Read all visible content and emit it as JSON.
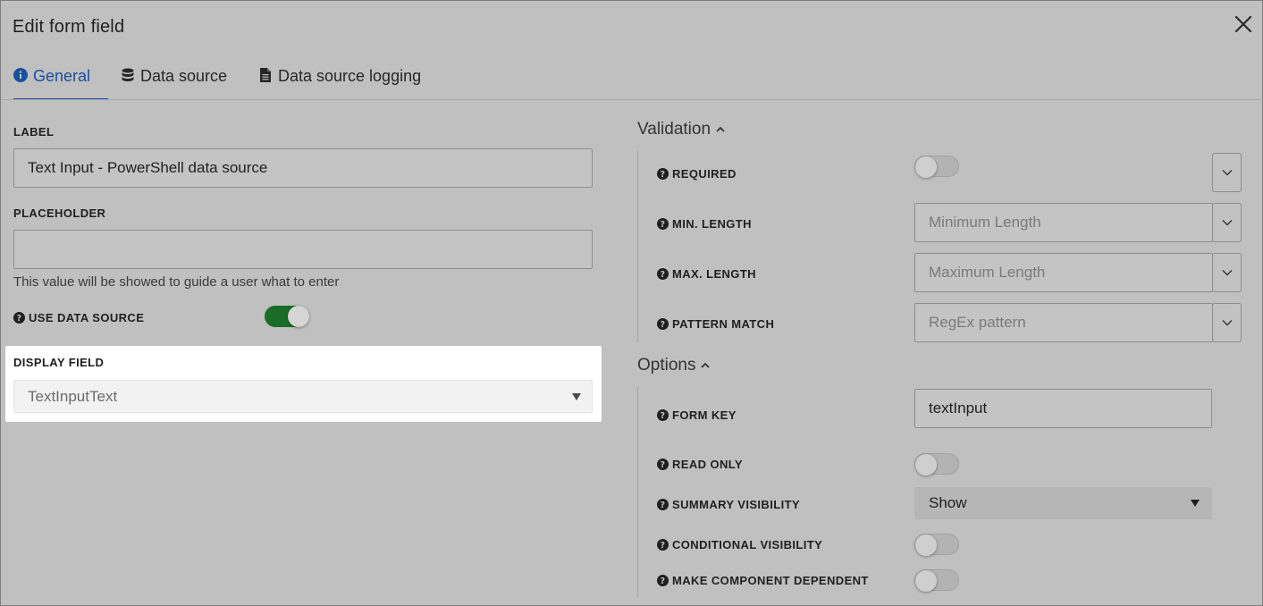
{
  "dialog": {
    "title": "Edit form field"
  },
  "tabs": [
    {
      "label": "General",
      "icon": "info-circle-icon",
      "active": true
    },
    {
      "label": "Data source",
      "icon": "database-icon",
      "active": false
    },
    {
      "label": "Data source logging",
      "icon": "file-text-icon",
      "active": false
    }
  ],
  "general": {
    "label_heading": "LABEL",
    "label_value": "Text Input - PowerShell data source",
    "placeholder_heading": "PLACEHOLDER",
    "placeholder_value": "",
    "placeholder_hint": "This value will be showed to guide a user what to enter",
    "use_data_source_label": "USE DATA SOURCE",
    "use_data_source_on": true,
    "display_field_heading": "DISPLAY FIELD",
    "display_field_value": "TextInputText"
  },
  "validation": {
    "title": "Validation",
    "required_label": "REQUIRED",
    "required_on": false,
    "min_length_label": "MIN. LENGTH",
    "min_length_placeholder": "Minimum Length",
    "max_length_label": "MAX. LENGTH",
    "max_length_placeholder": "Maximum Length",
    "pattern_label": "PATTERN MATCH",
    "pattern_placeholder": "RegEx pattern"
  },
  "options": {
    "title": "Options",
    "form_key_label": "FORM KEY",
    "form_key_value": "textInput",
    "read_only_label": "READ ONLY",
    "summary_visibility_label": "SUMMARY VISIBILITY",
    "summary_visibility_value": "Show",
    "conditional_visibility_label": "CONDITIONAL VISIBILITY",
    "make_dependent_label": "MAKE COMPONENT DEPENDENT"
  },
  "colors": {
    "accent": "#1a4fa0",
    "toggle_on": "#1a6d27",
    "background": "#c0c0c0",
    "highlight": "#ffffff"
  }
}
